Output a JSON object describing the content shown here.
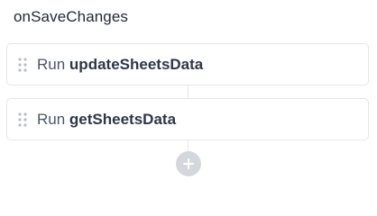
{
  "handler": {
    "title": "onSaveChanges"
  },
  "steps": [
    {
      "verb": "Run",
      "function_name": "updateSheetsData",
      "handle_icon": "drag-handle-icon"
    },
    {
      "verb": "Run",
      "function_name": "getSheetsData",
      "handle_icon": "drag-handle-icon"
    }
  ],
  "add_button": {
    "icon": "plus-icon"
  },
  "colors": {
    "card_border": "#e3e6ea",
    "handle_dots": "#b8bec6",
    "add_button_bg": "#d4d8dd",
    "text_primary": "#2d3748"
  }
}
